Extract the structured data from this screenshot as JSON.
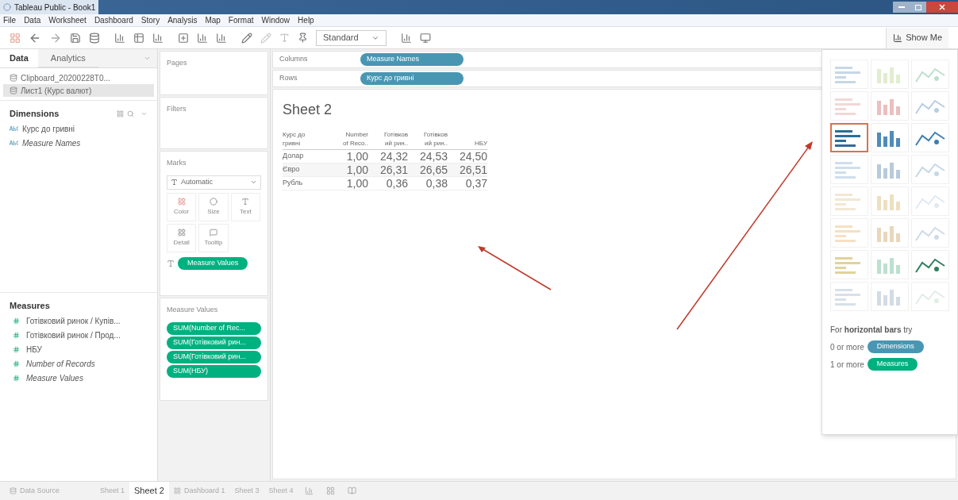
{
  "window": {
    "title": "Tableau Public - Book1"
  },
  "menu": [
    "File",
    "Data",
    "Worksheet",
    "Dashboard",
    "Story",
    "Analysis",
    "Map",
    "Format",
    "Window",
    "Help"
  ],
  "toolbar": {
    "fit": "Standard",
    "show_me": "Show Me"
  },
  "data_panel": {
    "tabs": [
      {
        "label": "Data",
        "selected": true
      },
      {
        "label": "Analytics",
        "selected": false
      }
    ],
    "sources": [
      {
        "name": "Clipboard_20200228T0...",
        "selected": false
      },
      {
        "name": "Лист1 (Курс валют)",
        "selected": true
      }
    ],
    "dimensions": {
      "title": "Dimensions",
      "fields": [
        {
          "name": "Курс до гривні",
          "generated": false
        },
        {
          "name": "Measure Names",
          "generated": true
        }
      ]
    },
    "measures": {
      "title": "Measures",
      "fields": [
        {
          "name": "Готівковий ринок / Купів...",
          "generated": false
        },
        {
          "name": "Готівковий ринок / Прод...",
          "generated": false
        },
        {
          "name": "НБУ",
          "generated": false
        },
        {
          "name": "Number of Records",
          "generated": true
        },
        {
          "name": "Measure Values",
          "generated": true
        }
      ]
    }
  },
  "pages": {
    "title": "Pages"
  },
  "filters": {
    "title": "Filters"
  },
  "marks": {
    "title": "Marks",
    "type": "Automatic",
    "cards": [
      "Color",
      "Size",
      "Text",
      "Detail",
      "Tooltip"
    ],
    "pill": "Measure Values"
  },
  "measure_values": {
    "title": "Measure Values",
    "pills": [
      "SUM(Number of Rec...",
      "SUM(Готівковий рин...",
      "SUM(Готівковий рин...",
      "SUM(НБУ)"
    ]
  },
  "shelves": [
    {
      "label": "Columns",
      "pill": "Measure Names"
    },
    {
      "label": "Rows",
      "pill": "Курс до гривні"
    }
  ],
  "sheet": {
    "title": "Sheet 2",
    "row_header": "Курс до\nгривні",
    "columns": [
      "Number\nof Reco..",
      "Готівков\nий рин..",
      "Готівков\nий рин..",
      "НБУ"
    ],
    "rows": [
      {
        "label": "Долар",
        "cells": [
          "1,00",
          "24,32",
          "24,53",
          "24,50"
        ]
      },
      {
        "label": "Євро",
        "cells": [
          "1,00",
          "26,31",
          "26,65",
          "26,51"
        ]
      },
      {
        "label": "Рубль",
        "cells": [
          "1,00",
          "0,36",
          "0,38",
          "0,37"
        ]
      }
    ]
  },
  "show_me": {
    "charts": [
      {
        "selected": false
      },
      {
        "selected": false
      },
      {
        "selected": false
      },
      {
        "selected": false
      },
      {
        "selected": false
      },
      {
        "selected": false
      },
      {
        "selected": true
      },
      {
        "selected": false
      },
      {
        "selected": false
      },
      {
        "selected": false
      },
      {
        "selected": false
      },
      {
        "selected": false
      },
      {
        "selected": false
      },
      {
        "selected": false
      },
      {
        "selected": false
      },
      {
        "selected": false
      },
      {
        "selected": false
      },
      {
        "selected": false
      },
      {
        "selected": false
      },
      {
        "selected": false
      },
      {
        "selected": false
      },
      {
        "selected": false
      },
      {
        "selected": false
      },
      {
        "selected": false
      }
    ],
    "hint": "For **horizontal bars** try",
    "requirements": [
      {
        "text": "0 or more",
        "pill": "Dimensions",
        "kind": "dimension"
      },
      {
        "text": "1 or more",
        "pill": "Measures",
        "kind": "measure"
      }
    ]
  },
  "sheet_tabs": [
    {
      "label": "Data Source",
      "kind": "data_source",
      "selected": false
    },
    {
      "label": "Sheet 1",
      "kind": "sheet",
      "selected": false
    },
    {
      "label": "Sheet 2",
      "kind": "sheet",
      "selected": true
    },
    {
      "label": "Dashboard 1",
      "kind": "dashboard",
      "selected": false
    },
    {
      "label": "Sheet 3",
      "kind": "sheet",
      "selected": false
    },
    {
      "label": "Sheet 4",
      "kind": "sheet",
      "selected": false
    }
  ]
}
